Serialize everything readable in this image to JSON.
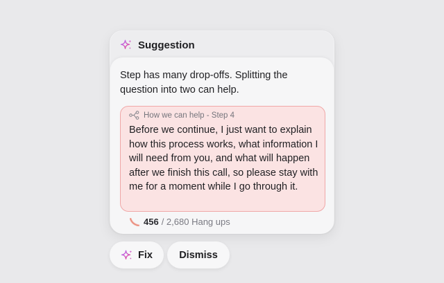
{
  "colors": {
    "background": "#e9e9eb",
    "sparkle_gradient": [
      "#b06bff",
      "#e9438f"
    ],
    "quote_background": "#fbe3e3",
    "quote_border": "#f0a7a7",
    "dropoff_accent": "#e88a7a"
  },
  "suggestion": {
    "title": "Suggestion",
    "icon": "sparkle-icon",
    "description": "Step has many drop-offs. Splitting the question into two can help.",
    "quote": {
      "meta_icon": "flow-icon",
      "meta": "How we can help - Step 4",
      "text": "Before we continue, I just want to explain how this process works, what information I will need from you, and what will happen after we finish this call, so please stay with me for a moment while I go through it."
    },
    "stats": {
      "icon": "dropoff-icon",
      "count": "456",
      "rest": "/ 2,680 Hang ups"
    }
  },
  "actions": {
    "fix_label": "Fix",
    "dismiss_label": "Dismiss"
  }
}
